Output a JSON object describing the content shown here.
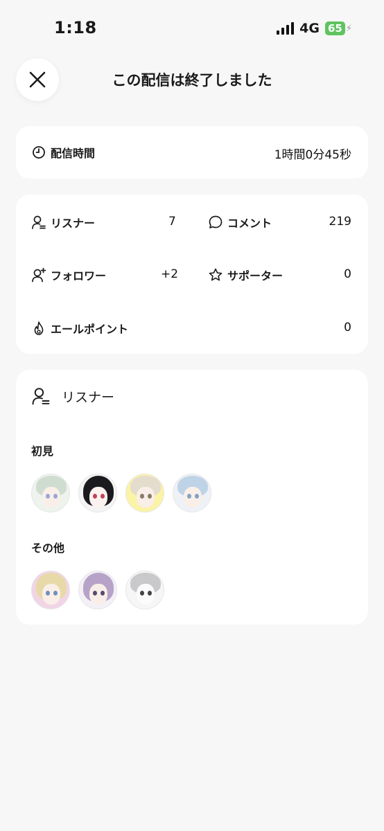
{
  "status": {
    "time": "1:18",
    "network": "4G",
    "battery": "65"
  },
  "header": {
    "title": "この配信は終了しました"
  },
  "duration": {
    "label": "配信時間",
    "value": "1時間0分45秒"
  },
  "stats": {
    "listeners": {
      "label": "リスナー",
      "value": "7"
    },
    "comments": {
      "label": "コメント",
      "value": "219"
    },
    "followers": {
      "label": "フォロワー",
      "value": "+2"
    },
    "supporters": {
      "label": "サポーター",
      "value": "0"
    },
    "yell_points": {
      "label": "エールポイント",
      "value": "0"
    }
  },
  "listeners_section": {
    "title": "リスナー",
    "groups": [
      {
        "label": "初見",
        "avatars": [
          "avatar-1",
          "avatar-2",
          "avatar-3",
          "avatar-4"
        ]
      },
      {
        "label": "その他",
        "avatars": [
          "avatar-5",
          "avatar-6",
          "avatar-7"
        ]
      }
    ]
  },
  "colors": {
    "background": "#f7f7f7",
    "card": "#ffffff",
    "battery": "#5fc45f"
  }
}
